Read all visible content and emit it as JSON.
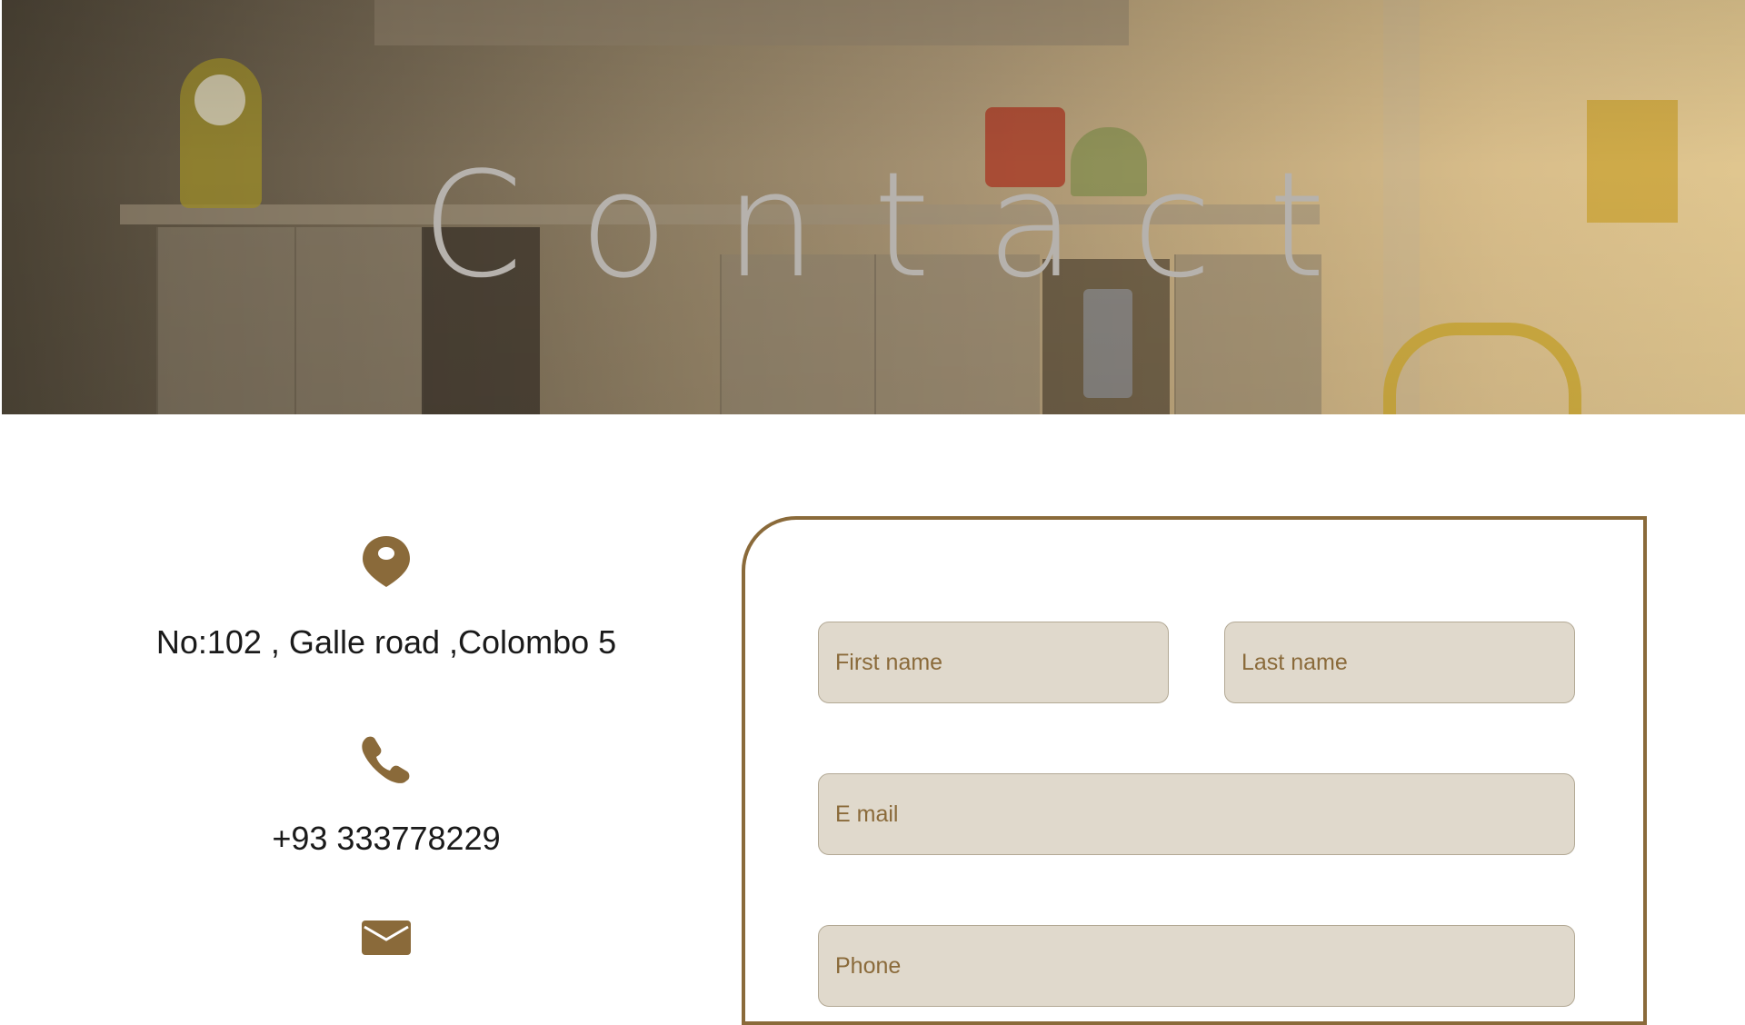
{
  "hero": {
    "title": "Contact"
  },
  "contact_info": {
    "address": "No:102 , Galle road ,Colombo 5",
    "phone": "+93 333778229",
    "icons": [
      "map-pin-icon",
      "phone-icon",
      "envelope-icon"
    ]
  },
  "form": {
    "first_name_placeholder": "First name",
    "last_name_placeholder": "Last name",
    "email_placeholder": "E mail",
    "phone_placeholder": "Phone"
  },
  "colors": {
    "accent": "#8a6a3a",
    "field_bg": "#e0d9cc",
    "title_text": "#b6b2ad"
  }
}
